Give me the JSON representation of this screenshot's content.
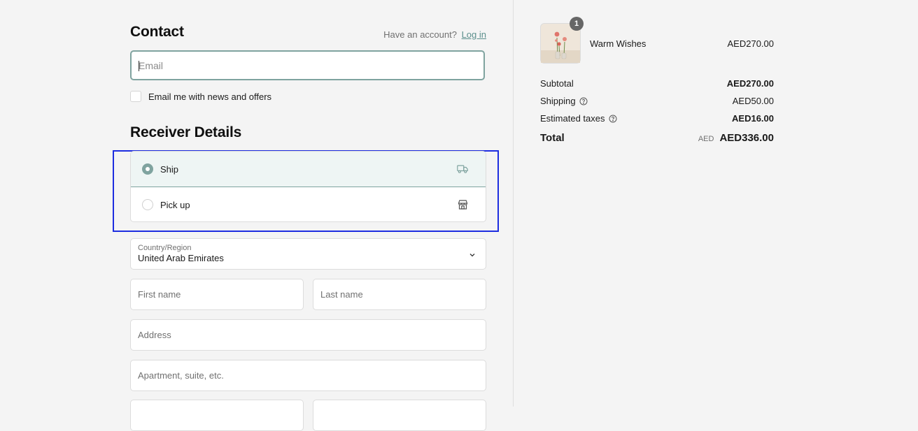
{
  "contact": {
    "title": "Contact",
    "have_account": "Have an account?",
    "login_link": "Log in",
    "email_placeholder": "Email",
    "newsletter_label": "Email me with news and offers"
  },
  "receiver": {
    "title": "Receiver Details",
    "options": [
      {
        "label": "Ship",
        "selected": true,
        "icon": "truck-icon"
      },
      {
        "label": "Pick up",
        "selected": false,
        "icon": "store-icon"
      }
    ],
    "country_label": "Country/Region",
    "country_value": "United Arab Emirates",
    "first_name_placeholder": "First name",
    "last_name_placeholder": "Last name",
    "address_placeholder": "Address",
    "apartment_placeholder": "Apartment, suite, etc."
  },
  "summary": {
    "product": {
      "name": "Warm Wishes",
      "price": "AED270.00",
      "quantity": "1"
    },
    "subtotal_label": "Subtotal",
    "subtotal_value": "AED270.00",
    "shipping_label": "Shipping",
    "shipping_value": "AED50.00",
    "taxes_label": "Estimated taxes",
    "taxes_value": "AED16.00",
    "total_label": "Total",
    "total_currency": "AED",
    "total_value": "AED336.00"
  },
  "colors": {
    "accent": "#7fa39f",
    "highlight_border": "#1d2de0",
    "background": "#f4f4f4"
  }
}
